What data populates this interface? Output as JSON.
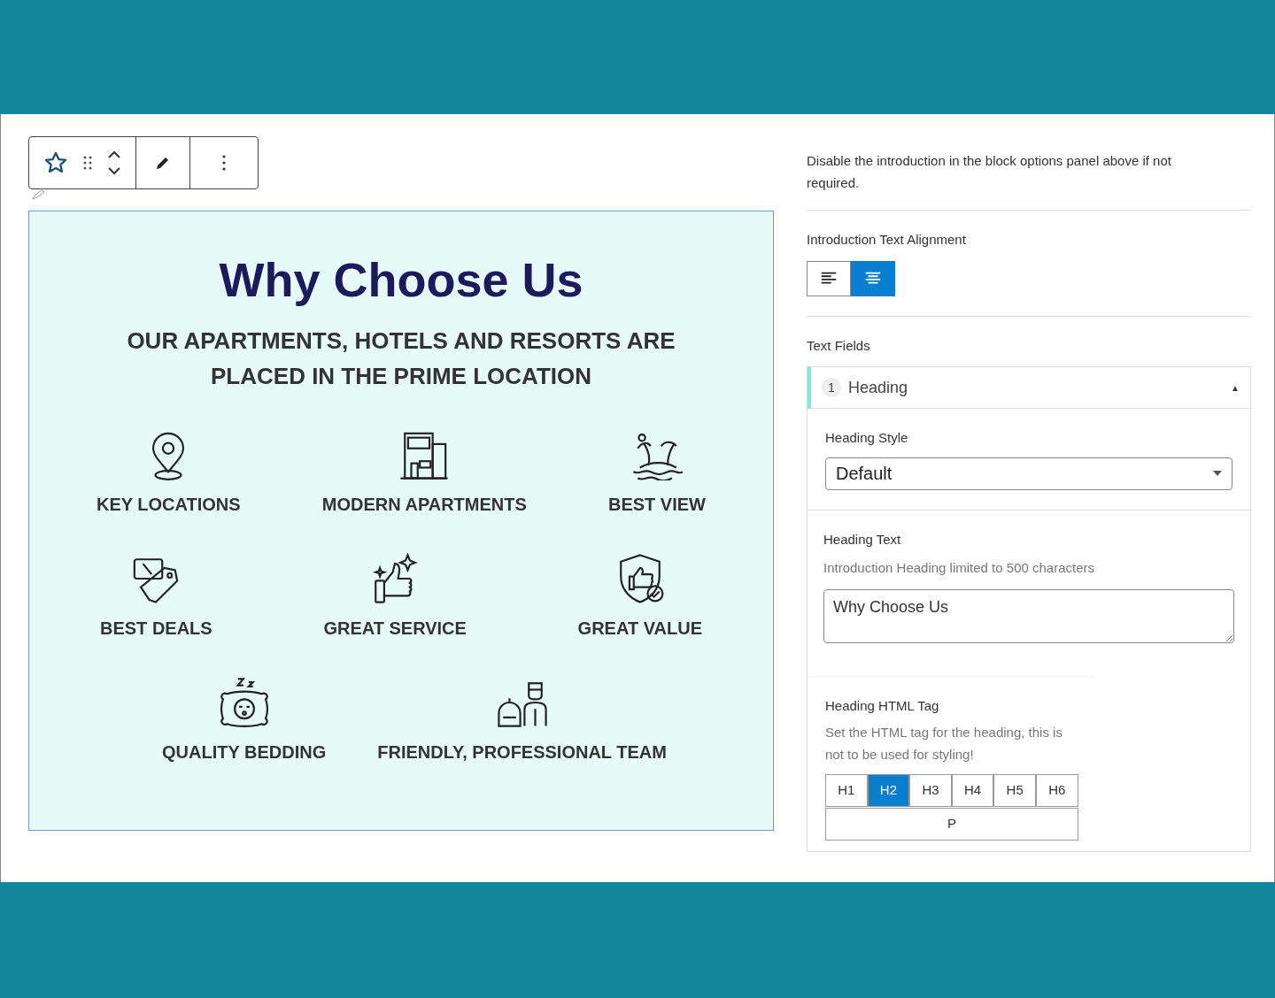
{
  "preview": {
    "heading": "Why Choose Us",
    "subheading": "OUR APARTMENTS, HOTELS AND RESORTS ARE PLACED IN THE PRIME LOCATION",
    "rows": [
      [
        {
          "label": "KEY LOCATIONS"
        },
        {
          "label": "MODERN APARTMENTS"
        },
        {
          "label": "BEST VIEW"
        }
      ],
      [
        {
          "label": "BEST DEALS"
        },
        {
          "label": "GREAT SERVICE"
        },
        {
          "label": "GREAT VALUE"
        }
      ],
      [
        {
          "label": "QUALITY BEDDING"
        },
        {
          "label": "FRIENDLY, PROFESSIONAL TEAM"
        }
      ]
    ]
  },
  "settings": {
    "note": "Disable the introduction in the block options panel above if not required.",
    "alignment": {
      "label": "Introduction Text Alignment",
      "options": [
        {
          "kind": "left",
          "selected": false
        },
        {
          "kind": "center",
          "selected": true
        }
      ]
    },
    "text_fields": {
      "label": "Text Fields",
      "item": {
        "number": "1",
        "title": "Heading",
        "expanded": true,
        "caret": "▲"
      },
      "style": {
        "label": "Heading Style",
        "value": "Default"
      },
      "heading_text": {
        "label": "Heading Text",
        "help": "Introduction Heading limited to 500 characters",
        "value": "Why Choose Us"
      },
      "html_tag": {
        "label": "Heading HTML Tag",
        "help": "Set the HTML tag for the heading, this is not to be used for styling!",
        "tags": [
          {
            "label": "H1",
            "selected": false
          },
          {
            "label": "H2",
            "selected": true
          },
          {
            "label": "H3",
            "selected": false
          },
          {
            "label": "H4",
            "selected": false
          },
          {
            "label": "H5",
            "selected": false
          },
          {
            "label": "H6",
            "selected": false
          },
          {
            "label": "P",
            "selected": false
          }
        ]
      }
    }
  }
}
